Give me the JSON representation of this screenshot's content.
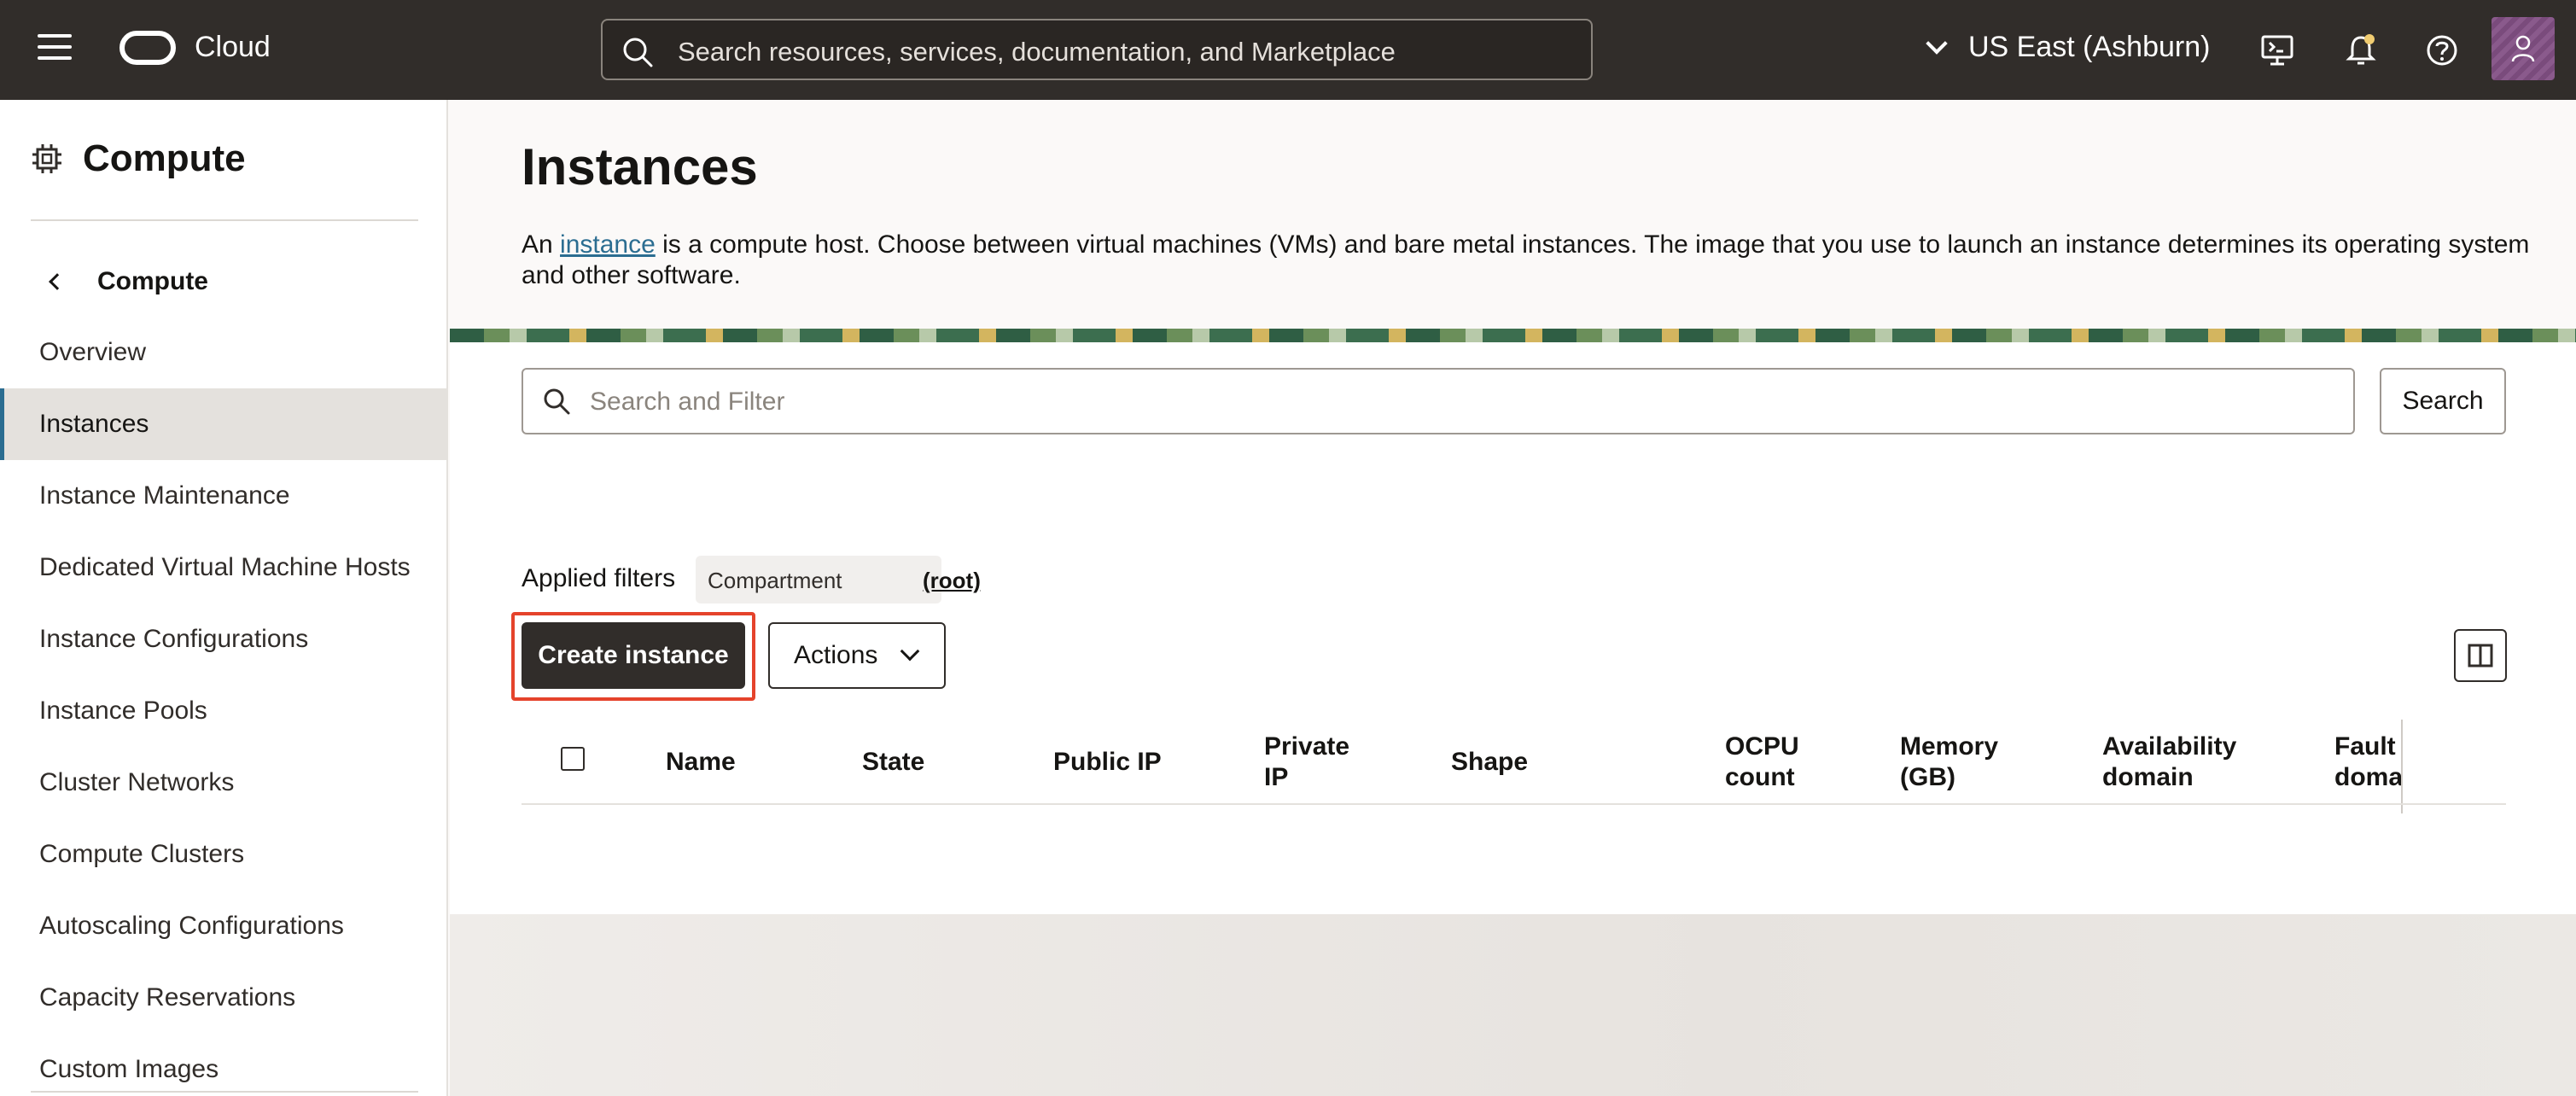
{
  "header": {
    "brand": "Cloud",
    "search_placeholder": "Search resources, services, documentation, and Marketplace",
    "region": "US East (Ashburn)"
  },
  "sidebar": {
    "title": "Compute",
    "back_label": "Compute",
    "items": [
      {
        "label": "Overview"
      },
      {
        "label": "Instances",
        "active": true
      },
      {
        "label": "Instance Maintenance"
      },
      {
        "label": "Dedicated Virtual Machine Hosts"
      },
      {
        "label": "Instance Configurations"
      },
      {
        "label": "Instance Pools"
      },
      {
        "label": "Cluster Networks"
      },
      {
        "label": "Compute Clusters"
      },
      {
        "label": "Autoscaling Configurations"
      },
      {
        "label": "Capacity Reservations"
      },
      {
        "label": "Custom Images"
      }
    ]
  },
  "main": {
    "title": "Instances",
    "description_prefix": "An ",
    "description_link": "instance",
    "description_suffix": " is a compute host. Choose between virtual machines (VMs) and bare metal instances. The image that you use to launch an instance determines its operating system and other software.",
    "filter_placeholder": "Search and Filter",
    "search_button": "Search",
    "applied_filters_label": "Applied filters",
    "filter_chip_key": "Compartment",
    "filter_chip_value": "(root)",
    "create_button": "Create instance",
    "actions_button": "Actions",
    "table_headers": [
      [
        "Name"
      ],
      [
        "State"
      ],
      [
        "Public IP"
      ],
      [
        "Private",
        "IP"
      ],
      [
        "Shape"
      ],
      [
        "OCPU",
        "count"
      ],
      [
        "Memory",
        "(GB)"
      ],
      [
        "Availability",
        "domain"
      ],
      [
        "Fault",
        "domai"
      ]
    ]
  },
  "colors": {
    "header_bg": "#312d2a",
    "link": "#2b6d91",
    "highlight": "#e5432b",
    "active_nav": "#e4e1dd"
  }
}
